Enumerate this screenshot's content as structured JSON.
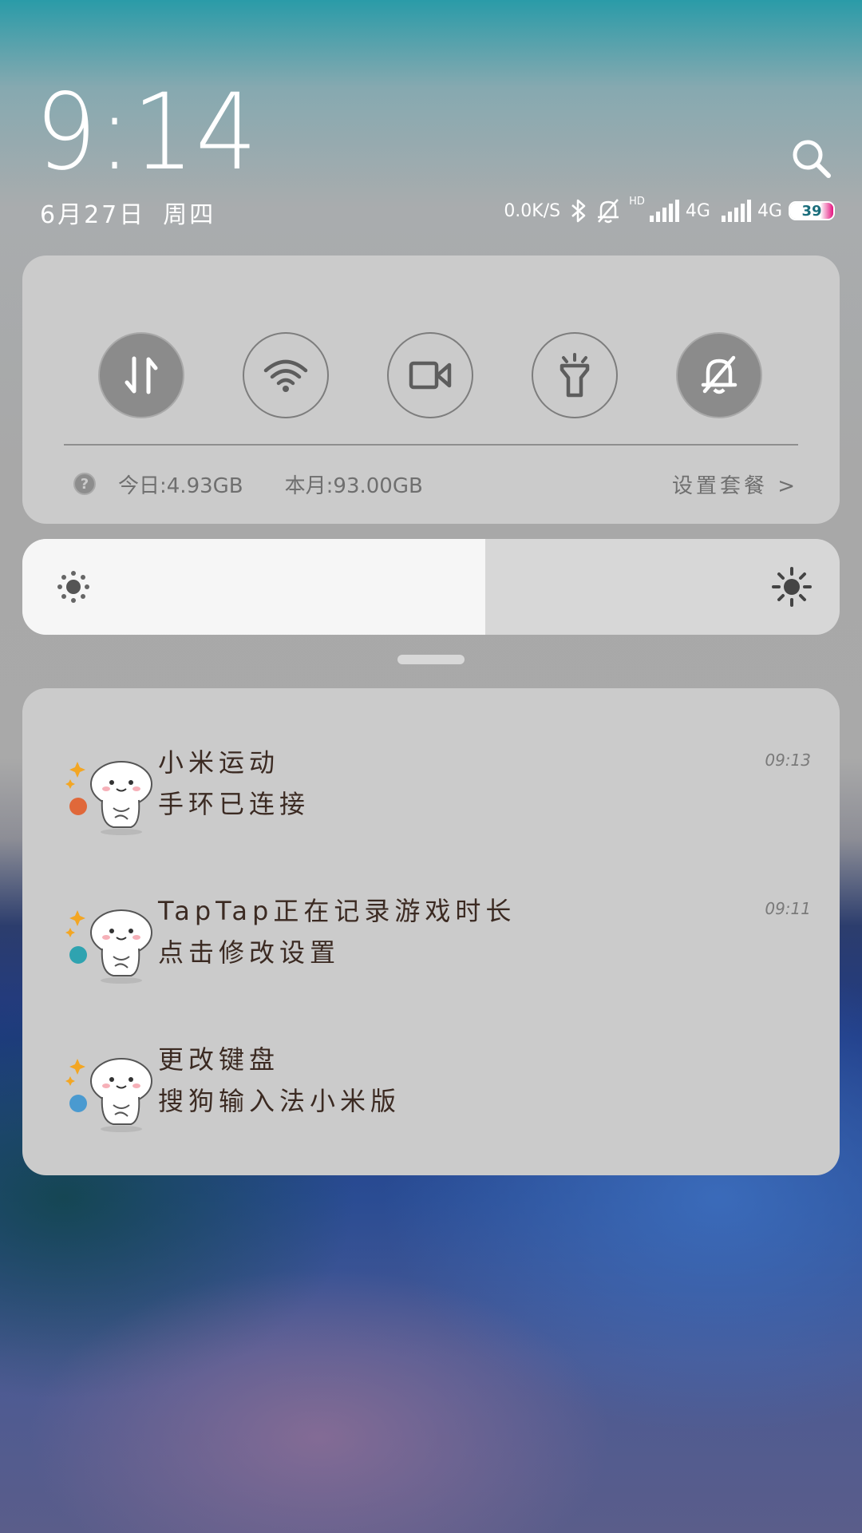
{
  "header": {
    "time": "9:14",
    "date": "6月27日",
    "weekday": "周四",
    "search_icon": "search-icon"
  },
  "status_bar": {
    "net_speed": "0.0K/S",
    "bluetooth_icon": "bluetooth-icon",
    "mute_icon": "bell-off-icon",
    "sim1_hd": "HD",
    "sim1_type": "4G",
    "sim2_type": "4G",
    "battery_level": "39",
    "battery_fill_color": "#e4147f"
  },
  "quick_settings": {
    "toggles": [
      {
        "name": "mobile-data",
        "icon": "data-arrows-icon",
        "active": true
      },
      {
        "name": "wifi",
        "icon": "wifi-icon",
        "active": false
      },
      {
        "name": "screen-recorder",
        "icon": "video-camera-icon",
        "active": false
      },
      {
        "name": "flashlight",
        "icon": "flashlight-icon",
        "active": false
      },
      {
        "name": "silent-mode",
        "icon": "bell-off-icon",
        "active": true
      }
    ],
    "data_usage": {
      "today": "今日:4.93GB",
      "month": "本月:93.00GB",
      "plan_link": "设置套餐 >"
    }
  },
  "brightness": {
    "level_fraction": 0.566
  },
  "notifications": [
    {
      "app_icon": "cartoon-avatar-icon",
      "accent": "#e0683a",
      "title": "小米运动",
      "body": "手环已连接",
      "time": "09:13"
    },
    {
      "app_icon": "cartoon-avatar-icon",
      "accent": "#2fa3b0",
      "title": "TapTap正在记录游戏时长",
      "body": "点击修改设置",
      "time": "09:11"
    },
    {
      "app_icon": "cartoon-avatar-icon",
      "accent": "#4a9ad0",
      "title": "更改键盘",
      "body": "搜狗输入法小米版",
      "time": ""
    }
  ]
}
